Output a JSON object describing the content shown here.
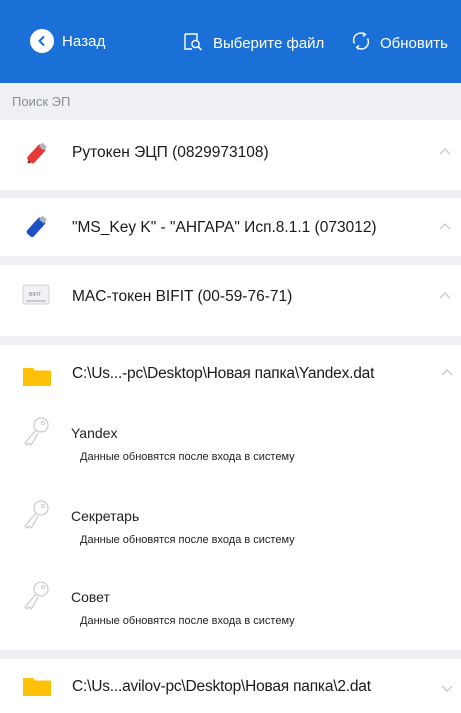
{
  "toolbar": {
    "back_label": "Назад",
    "choose_file_label": "Выберите файл",
    "refresh_label": "Обновить"
  },
  "search": {
    "label": "Поиск ЭП"
  },
  "tokens": [
    {
      "title": "Рутокен ЭЦП (0829973108)",
      "icon": "red-usb-token-icon"
    },
    {
      "title": "\"MS_Key K\" - \"АНГАРА\" Исп.8.1.1 (073012)",
      "icon": "blue-usb-token-icon"
    },
    {
      "title": "MAC-токен BIFIT (00-59-76-71)",
      "icon": "bifit-token-icon"
    }
  ],
  "bifit_badge": "BIFIT",
  "folders": [
    {
      "path": "C:\\Us...-pc\\Desktop\\Новая папка\\Yandex.dat",
      "expanded": true,
      "keys": [
        {
          "name": "Yandex",
          "status": "Данные обновятся после входа в систему"
        },
        {
          "name": "Секретарь",
          "status": "Данные обновятся после входа в систему"
        },
        {
          "name": "Совет",
          "status": "Данные обновятся после входа в систему"
        }
      ]
    },
    {
      "path": "C:\\Us...avilov-pc\\Desktop\\Новая папка\\2.dat",
      "expanded": false
    }
  ],
  "colors": {
    "toolbar_bg": "#1b70d8",
    "separator_bg": "#eef0f3",
    "folder_yellow": "#ffc107"
  }
}
